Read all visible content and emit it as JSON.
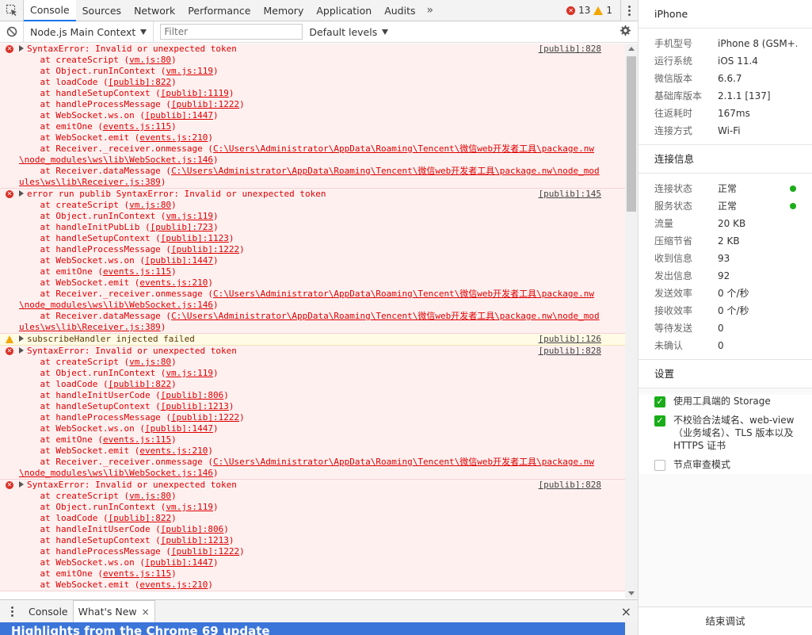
{
  "devtools": {
    "tabs": [
      "Console",
      "Sources",
      "Network",
      "Performance",
      "Memory",
      "Application",
      "Audits"
    ],
    "active_tab": "Console",
    "more_tabs": "»",
    "error_count": "13",
    "warning_count": "1",
    "context": "Node.js Main Context",
    "filter_placeholder": "Filter",
    "levels": "Default levels"
  },
  "console": {
    "messages": [
      {
        "level": "error",
        "text": "SyntaxError: Invalid or unexpected token",
        "source": "[publib]:828",
        "frames": [
          [
            "    at createScript (",
            "vm.js:80",
            ")"
          ],
          [
            "    at Object.runInContext (",
            "vm.js:119",
            ")"
          ],
          [
            "    at loadCode (",
            "[publib]:822",
            ")"
          ],
          [
            "    at handleSetupContext (",
            "[publib]:1119",
            ")"
          ],
          [
            "    at handleProcessMessage (",
            "[publib]:1222",
            ")"
          ],
          [
            "    at WebSocket.ws.on (",
            "[publib]:1447",
            ")"
          ],
          [
            "    at emitOne (",
            "events.js:115",
            ")"
          ],
          [
            "    at WebSocket.emit (",
            "events.js:210",
            ")"
          ],
          [
            "    at Receiver._receiver.onmessage (",
            "C:\\Users\\Administrator\\AppData\\Roaming\\Tencent\\微信web开发者工具\\package.nw",
            ""
          ],
          [
            "",
            "\\node_modules\\ws\\lib\\WebSocket.js:146",
            ")"
          ],
          [
            "    at Receiver.dataMessage (",
            "C:\\Users\\Administrator\\AppData\\Roaming\\Tencent\\微信web开发者工具\\package.nw\\node_mod",
            ""
          ],
          [
            "",
            "ules\\ws\\lib\\Receiver.js:389",
            ")"
          ]
        ]
      },
      {
        "level": "error",
        "text": "error run publib SyntaxError: Invalid or unexpected token",
        "source": "[publib]:145",
        "frames": [
          [
            "    at createScript (",
            "vm.js:80",
            ")"
          ],
          [
            "    at Object.runInContext (",
            "vm.js:119",
            ")"
          ],
          [
            "    at handleInitPubLib (",
            "[publib]:723",
            ")"
          ],
          [
            "    at handleSetupContext (",
            "[publib]:1123",
            ")"
          ],
          [
            "    at handleProcessMessage (",
            "[publib]:1222",
            ")"
          ],
          [
            "    at WebSocket.ws.on (",
            "[publib]:1447",
            ")"
          ],
          [
            "    at emitOne (",
            "events.js:115",
            ")"
          ],
          [
            "    at WebSocket.emit (",
            "events.js:210",
            ")"
          ],
          [
            "    at Receiver._receiver.onmessage (",
            "C:\\Users\\Administrator\\AppData\\Roaming\\Tencent\\微信web开发者工具\\package.nw",
            ""
          ],
          [
            "",
            "\\node_modules\\ws\\lib\\WebSocket.js:146",
            ")"
          ],
          [
            "    at Receiver.dataMessage (",
            "C:\\Users\\Administrator\\AppData\\Roaming\\Tencent\\微信web开发者工具\\package.nw\\node_mod",
            ""
          ],
          [
            "",
            "ules\\ws\\lib\\Receiver.js:389",
            ")"
          ]
        ]
      },
      {
        "level": "warning",
        "text": "subscribeHandler injected failed",
        "source": "[publib]:126",
        "frames": []
      },
      {
        "level": "error",
        "text": "SyntaxError: Invalid or unexpected token",
        "source": "[publib]:828",
        "frames": [
          [
            "    at createScript (",
            "vm.js:80",
            ")"
          ],
          [
            "    at Object.runInContext (",
            "vm.js:119",
            ")"
          ],
          [
            "    at loadCode (",
            "[publib]:822",
            ")"
          ],
          [
            "    at handleInitUserCode (",
            "[publib]:806",
            ")"
          ],
          [
            "    at handleSetupContext (",
            "[publib]:1213",
            ")"
          ],
          [
            "    at handleProcessMessage (",
            "[publib]:1222",
            ")"
          ],
          [
            "    at WebSocket.ws.on (",
            "[publib]:1447",
            ")"
          ],
          [
            "    at emitOne (",
            "events.js:115",
            ")"
          ],
          [
            "    at WebSocket.emit (",
            "events.js:210",
            ")"
          ],
          [
            "    at Receiver._receiver.onmessage (",
            "C:\\Users\\Administrator\\AppData\\Roaming\\Tencent\\微信web开发者工具\\package.nw",
            ""
          ],
          [
            "",
            "\\node_modules\\ws\\lib\\WebSocket.js:146",
            ")"
          ]
        ]
      },
      {
        "level": "error",
        "text": "SyntaxError: Invalid or unexpected token",
        "source": "[publib]:828",
        "frames": [
          [
            "    at createScript (",
            "vm.js:80",
            ")"
          ],
          [
            "    at Object.runInContext (",
            "vm.js:119",
            ")"
          ],
          [
            "    at loadCode (",
            "[publib]:822",
            ")"
          ],
          [
            "    at handleInitUserCode (",
            "[publib]:806",
            ")"
          ],
          [
            "    at handleSetupContext (",
            "[publib]:1213",
            ")"
          ],
          [
            "    at handleProcessMessage (",
            "[publib]:1222",
            ")"
          ],
          [
            "    at WebSocket.ws.on (",
            "[publib]:1447",
            ")"
          ],
          [
            "    at emitOne (",
            "events.js:115",
            ")"
          ],
          [
            "    at WebSocket.emit (",
            "events.js:210",
            ")"
          ]
        ]
      }
    ]
  },
  "drawer": {
    "tabs": [
      "Console",
      "What's New"
    ],
    "active_tab": "What's New",
    "close": "×",
    "tab_close": "×",
    "banner": "Highlights from the Chrome 69 update"
  },
  "panel": {
    "device_title": "iPhone",
    "device_info": [
      {
        "k": "手机型号",
        "v": "iPhone 8 (GSM+..."
      },
      {
        "k": "运行系统",
        "v": "iOS 11.4"
      },
      {
        "k": "微信版本",
        "v": "6.6.7"
      },
      {
        "k": "基础库版本",
        "v": "2.1.1 [137]"
      },
      {
        "k": "往返耗时",
        "v": "167ms"
      },
      {
        "k": "连接方式",
        "v": "Wi-Fi"
      }
    ],
    "conn_title": "连接信息",
    "conn_info": [
      {
        "k": "连接状态",
        "v": "正常",
        "dot": true
      },
      {
        "k": "服务状态",
        "v": "正常",
        "dot": true
      },
      {
        "k": "流量",
        "v": "20 KB"
      },
      {
        "k": "压缩节省",
        "v": "2 KB"
      },
      {
        "k": "收到信息",
        "v": "93"
      },
      {
        "k": "发出信息",
        "v": "92"
      },
      {
        "k": "发送效率",
        "v": "0 个/秒"
      },
      {
        "k": "接收效率",
        "v": "0 个/秒"
      },
      {
        "k": "等待发送",
        "v": "0"
      },
      {
        "k": "未确认",
        "v": "0"
      }
    ],
    "settings_title": "设置",
    "settings": [
      {
        "label": "使用工具端的 Storage",
        "checked": true
      },
      {
        "label": "不校验合法域名、web-view（业务域名）、TLS 版本以及 HTTPS 证书",
        "checked": true
      },
      {
        "label": "节点审查模式",
        "checked": false
      }
    ],
    "end_button": "结束调试"
  },
  "colors": {
    "error_bg": "#fff0f0",
    "error_text": "#dd0000",
    "warning_bg": "#fffbe5",
    "status_green": "#1aad19",
    "banner_blue": "#3b75d9"
  }
}
